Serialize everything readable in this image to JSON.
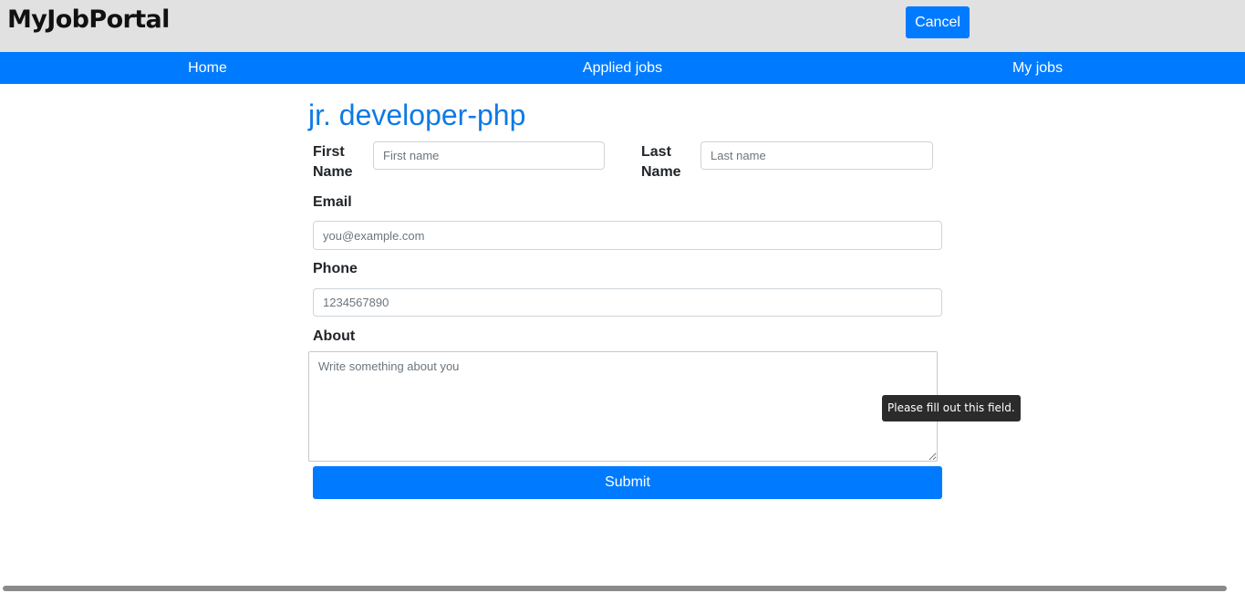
{
  "header": {
    "brand": "MyJobPortal",
    "cancel_label": "Cancel"
  },
  "nav": {
    "items": [
      {
        "label": "Home"
      },
      {
        "label": "Applied jobs"
      },
      {
        "label": "My jobs"
      }
    ]
  },
  "form": {
    "job_title": "jr. developer-php",
    "first_name": {
      "label_line1": "First",
      "label_line2": "Name",
      "placeholder": "First name",
      "value": ""
    },
    "last_name": {
      "label_line1": "Last",
      "label_line2": "Name",
      "placeholder": "Last name",
      "value": ""
    },
    "email": {
      "label": "Email",
      "placeholder": "you@example.com",
      "value": ""
    },
    "phone": {
      "label": "Phone",
      "placeholder": "1234567890",
      "value": ""
    },
    "about": {
      "label": "About",
      "placeholder": "Write something about you",
      "value": ""
    },
    "validation_tooltip": "Please fill out this field.",
    "submit_label": "Submit"
  },
  "colors": {
    "primary": "#007bff",
    "title": "#0f7ae5",
    "topbar_bg": "#e1e1e1",
    "tooltip_bg": "#2b2b2b"
  }
}
